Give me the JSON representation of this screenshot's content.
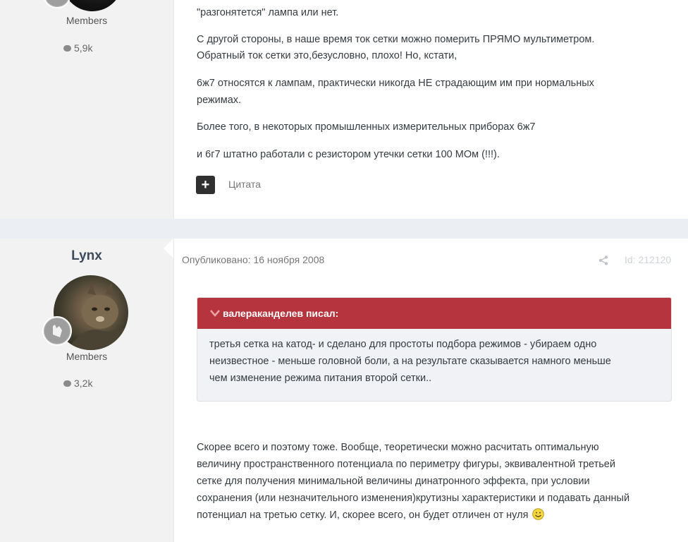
{
  "post1": {
    "rank": "Members",
    "post_count": "5,9k",
    "paragraphs": [
      "\"разгонятется\" лампа или нет.",
      "С другой стороны, в наше время ток сетки можно померить ПРЯМО мультиметром.",
      "Обратный ток сетки это,безусловно, плохо! Но, кстати,",
      "6ж7 относятся к лампам, практически никогда НЕ страдающим им при нормальных",
      "режимах.",
      "Более того, в некоторых промышленных измерительных приборах 6ж7",
      "и 6г7 штатно работали с резистором утечки сетки 100 МОм (!!!)."
    ],
    "plus_label": "+",
    "quote_label": "Цитата"
  },
  "post2": {
    "username": "Lynx",
    "rank": "Members",
    "post_count": "3,2k",
    "published": "Опубликовано: 16 ноября 2008",
    "post_id": "Id: 212120",
    "quote_author": "валераканделев писал:",
    "quote_lines": [
      "третья сетка на катод- и сделано для простоты подбора режимов - убираем одно",
      "неизвестное - меньше головной боли, а на результате сказывается намного меньше",
      "чем изменение режима питания второй сетки.."
    ],
    "body_lines": [
      "Скорее всего и поэтому тоже. Вообще, теоретически можно расчитать оптимальную",
      "величину пространственного потенциала по периметру фигуры, эквивалентной третьей",
      "сетке для получения минимальной величины динатронного эффекта, при условии",
      "сохранения (или незначительного изменения)крутизны характеристики и подавать данный",
      "потенциал на третью сетку. И, скорее всего, он будет отличен от нуля"
    ]
  }
}
